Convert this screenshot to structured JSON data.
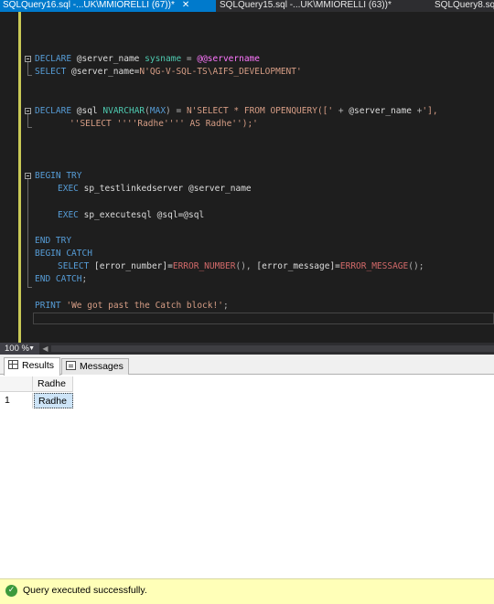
{
  "tabs": [
    {
      "label": "SQLQuery16.sql -...UK\\MMIORELLI (67))*",
      "active": true
    },
    {
      "label": "SQLQuery15.sql -...UK\\MMIORELLI (63))*",
      "active": false
    },
    {
      "label": "SQLQuery8.sq",
      "active": false
    }
  ],
  "tab_close_glyph": "✕",
  "editor": {
    "lines": {
      "l1": {
        "kw1": "DECLARE",
        "t1": " @server_name ",
        "tp1": "sysname",
        "t2": " = ",
        "sys1": "@@servername"
      },
      "l2": {
        "kw1": "SELECT",
        "t1": " @server_name=",
        "str1": "N'QG-V-SQL-TS\\AIFS_DEVELOPMENT'"
      },
      "l3": {
        "kw1": "DECLARE",
        "t1": " @sql ",
        "tp1": "NVARCHAR",
        "g1": "(",
        "tp2": "MAX",
        "g2": ")",
        "t2": " = ",
        "str1": "N'SELECT * FROM OPENQUERY([' ",
        "g3": "+",
        "t3": " @server_name ",
        "g4": "+",
        "str2": "'],"
      },
      "l4": {
        "str1": "''SELECT ''''Radhe'''' AS Radhe'');'"
      },
      "l5": {
        "kw1": "BEGIN TRY"
      },
      "l6": {
        "kw1": "EXEC",
        "t1": " sp_testlinkedserver @server_name"
      },
      "l7": {
        "kw1": "EXEC",
        "t1": " sp_executesql @sql=@sql"
      },
      "l8": {
        "kw1": "END TRY"
      },
      "l9": {
        "kw1": "BEGIN CATCH"
      },
      "l10": {
        "kw1": "SELECT",
        "t1": " [error_number]=",
        "fn1": "ERROR_NUMBER",
        "g1": "(),",
        "t2": " [error_message]=",
        "fn2": "ERROR_MESSAGE",
        "g2": "();"
      },
      "l11": {
        "kw1": "END CATCH",
        "g1": ";"
      },
      "l12": {
        "kw1": "PRINT",
        "t1": " ",
        "str1": "'We got past the Catch block!'",
        "g1": ";"
      }
    }
  },
  "zoom": {
    "value": "100 %"
  },
  "results": {
    "tabs": [
      {
        "label": "Results",
        "icon": "grid-icon",
        "active": true
      },
      {
        "label": "Messages",
        "icon": "messages-icon",
        "active": false
      }
    ],
    "columns": [
      "Radhe"
    ],
    "rows": [
      {
        "num": "1",
        "cells": [
          "Radhe"
        ]
      }
    ]
  },
  "status": {
    "icon": "success-check-icon",
    "glyph": "✓",
    "text": "Query executed successfully."
  },
  "colors": {
    "keyword": "#569cd6",
    "string": "#d69d85",
    "function": "#d16969",
    "system_var": "#ff77ff",
    "type": "#4ec9b0",
    "active_tab": "#007acc",
    "status_bar": "#ffffb8"
  }
}
